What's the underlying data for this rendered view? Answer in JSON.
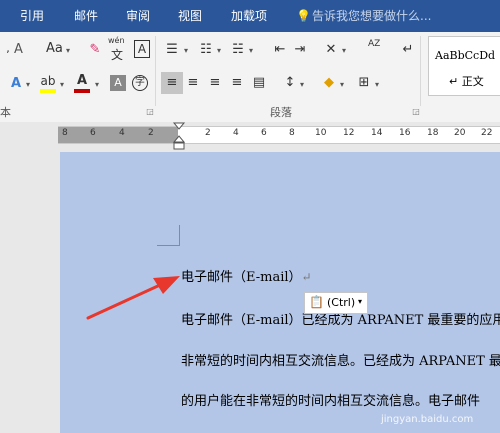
{
  "tabs": [
    {
      "label": "引用",
      "name": "tab-references"
    },
    {
      "label": "邮件",
      "name": "tab-mailings"
    },
    {
      "label": "审阅",
      "name": "tab-review"
    },
    {
      "label": "视图",
      "name": "tab-view"
    },
    {
      "label": "加载项",
      "name": "tab-addins"
    }
  ],
  "tell_me_placeholder": "告诉我您想要做什么...",
  "ribbon": {
    "font_group_partial_label": "本",
    "paragraph_group_label": "段落",
    "font_size_button": "Aa",
    "wen_label": "wén",
    "wen_char": "文",
    "boxed_A": "A",
    "sort_az": "AZ",
    "style_preview_text": "AaBbCcDd",
    "style_name": "↵ 正文"
  },
  "ruler": {
    "numbers": [
      "8",
      "6",
      "4",
      "2",
      "2",
      "4",
      "6",
      "8",
      "10",
      "12",
      "14",
      "16",
      "18",
      "20",
      "22"
    ]
  },
  "document": {
    "heading": "电子邮件（E-mail）",
    "line1": "电子邮件（E-mail）已经成为 ARPANET 最重要的应用",
    "line2": "非常短的时间内相互交流信息。已经成为 ARPANET 最",
    "line3": "的用户能在非常短的时间内相互交流信息。电子邮件"
  },
  "paste_options_label": "(Ctrl)",
  "watermark": "jingyan.baidu.com",
  "colors": {
    "accent": "#2b579a",
    "highlight": "#ffff00",
    "font_color": "#c00000",
    "page_selection": "#b4c6e7",
    "arrow": "#e8372c"
  }
}
